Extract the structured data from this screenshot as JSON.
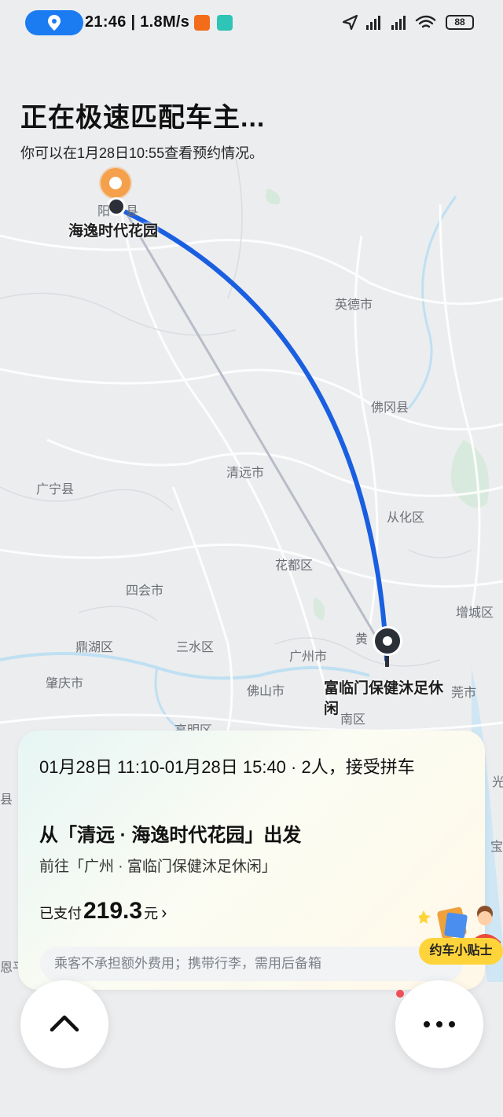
{
  "status_bar": {
    "time_speed": "21:46 | 1.8M/s",
    "battery": "88"
  },
  "header": {
    "title": "正在极速匹配车主...",
    "subtitle": "你可以在1月28日10:55查看预约情况。"
  },
  "map": {
    "origin_label": "海逸时代花园",
    "destination_label": "富临门保健沐足休闲",
    "place_labels": {
      "yingde": "英德市",
      "fogang": "佛冈县",
      "qingyuan": "清远市",
      "guangning": "广宁县",
      "conghua": "从化区",
      "huadu": "花都区",
      "sihui": "四会市",
      "zengcheng": "增城区",
      "dinghu": "鼎湖区",
      "sanshui": "三水区",
      "guangzhou": "广州市",
      "huang": "黄",
      "zhaoqing": "肇庆市",
      "foshan": "佛山市",
      "dongguan": "莞市",
      "nanhai": "南区",
      "gaoming": "高明区",
      "yang": "阳",
      "xian": "县",
      "xian2": "县",
      "guang": "光",
      "ping": "恩平",
      "bao": "宝"
    }
  },
  "order_card": {
    "time_info": "01月28日 11:10-01月28日 15:40 · 2人，接受拼车",
    "from": "从「清远 · 海逸时代花园」出发",
    "to": "前往「广州 · 富临门保健沐足休闲」",
    "paid_label": "已支付",
    "paid_amount": "219.3",
    "paid_unit": "元",
    "paid_chevron": "›",
    "notice": "乘客不承担额外费用；携带行李，需用后备箱"
  },
  "tips_button": {
    "label": "约车小贴士"
  },
  "icons": {
    "location": "location-pin-icon",
    "up": "chevron-up-icon",
    "more": "more-dots-icon",
    "navigation": "navigation-arrow-icon",
    "wifi": "wifi-icon",
    "signal": "signal-icon"
  },
  "colors": {
    "route": "#1a5fe0",
    "accent": "#1b7cf2",
    "tips": "#ffd43b",
    "origin_pin": "#f5a04a"
  }
}
